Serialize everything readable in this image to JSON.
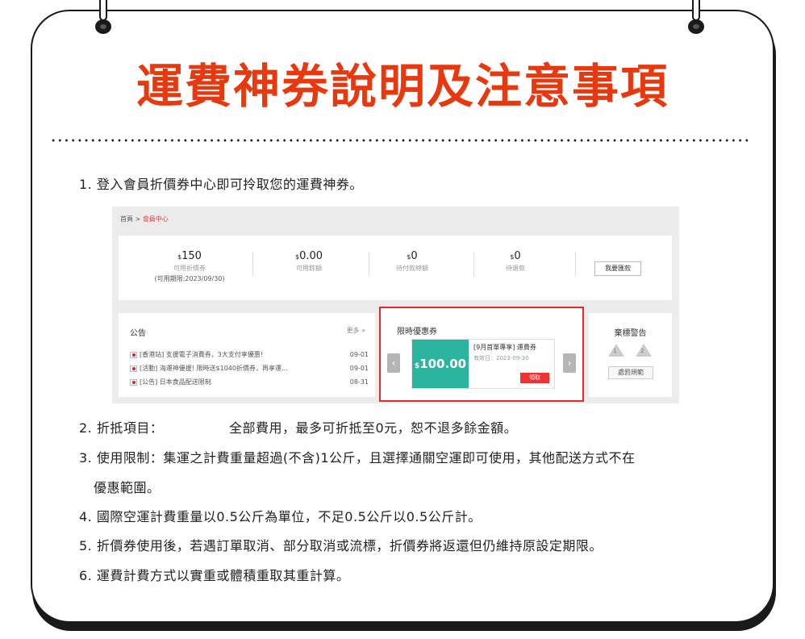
{
  "title": "運費神券說明及注意事項",
  "items": [
    "1. 登入會員折價券中心即可拎取您的運費神券。",
    "2. 折抵項目：",
    "全部費用，最多可折抵至0元，恕不退多餘金額。",
    "3. 使用限制：集運之計費重量超過(不含)1公斤，且選擇通關空運即可使用，其他配送方式不在",
    "優惠範圍。",
    "4. 國際空運計費重量以0.5公斤為單位，不足0.5公斤以0.5公斤計。",
    "5. 折價券使用後，若遇訂單取消、部分取消或流標，折價券將返還但仍維持原設定期限。",
    "6. 運費計費方式以實重或體積重取其重計算。"
  ],
  "screenshot": {
    "breadcrumb": {
      "home": "首頁",
      "sep": ">",
      "current": "會員中心"
    },
    "stats": [
      {
        "currency": "$",
        "amount": "150",
        "label": "可用折價券",
        "expiry": "(可用期限:2023/09/30)"
      },
      {
        "currency": "$",
        "amount": "0.00",
        "label": "可用餘額",
        "expiry": ""
      },
      {
        "currency": "$",
        "amount": "0",
        "label": "待付款總額",
        "expiry": ""
      },
      {
        "currency": "$",
        "amount": "0",
        "label": "待退款",
        "expiry": ""
      }
    ],
    "remit_button": "我要匯款",
    "notice": {
      "header": "公告",
      "more": "更多 »",
      "rows": [
        {
          "text": "[香港站] 支援電子消費券，3大支付享優惠!",
          "date": "09-01"
        },
        {
          "text": "[活動] 海運神優援! 限時送$1040折價券，再享運...",
          "date": "09-01"
        },
        {
          "text": "[公告] 日本食品配送限制",
          "date": "08-31"
        }
      ]
    },
    "coupon": {
      "header": "限時優惠券",
      "currency": "$",
      "amount": "100.00",
      "name": "[9月首單專享] 運費券",
      "validity": "有效日：2023-09-30",
      "claim": "領取",
      "prev": "‹",
      "next": "›"
    },
    "warning": {
      "header": "棄標警告",
      "levels": [
        "1",
        "2"
      ],
      "rule_button": "處罰規範"
    }
  }
}
